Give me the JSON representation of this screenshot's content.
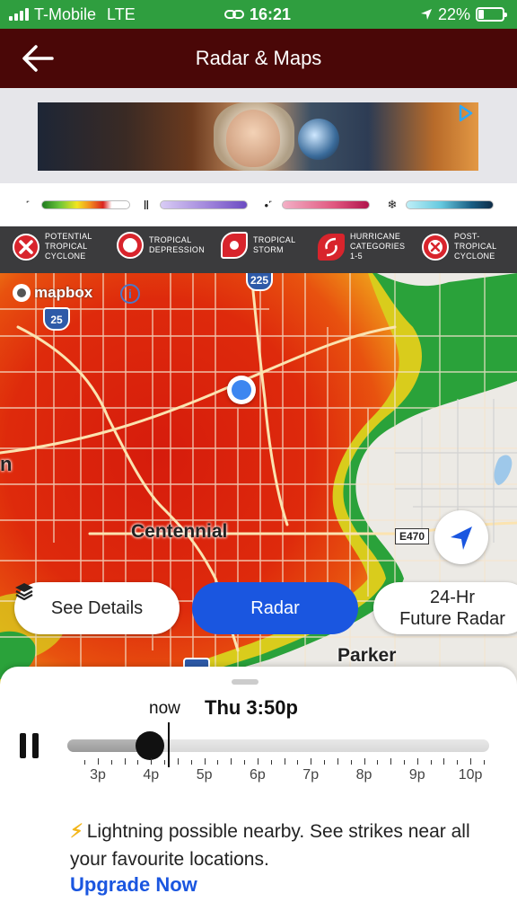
{
  "status_bar": {
    "carrier": "T-Mobile",
    "network": "LTE",
    "time": "16:21",
    "battery": "22%",
    "colors": {
      "background": "#2f9e3f"
    }
  },
  "header": {
    "title": "Radar & Maps",
    "back_icon": "arrow-left-icon",
    "background": "#4a0707"
  },
  "ad": {
    "choices_icon": "adchoices-icon"
  },
  "precip_legend": [
    {
      "icon": "rain-icon",
      "gradient": [
        "#1f7a1f",
        "#6cc63a",
        "#f2e51f",
        "#f28c1f",
        "#d9231f",
        "#ffffff"
      ]
    },
    {
      "icon": "sleet-icon",
      "gradient": [
        "#c9b8ef",
        "#9b7fd9",
        "#6b4bc2"
      ]
    },
    {
      "icon": "mix-icon",
      "gradient": [
        "#f3b0c6",
        "#e0577f",
        "#b0154c"
      ]
    },
    {
      "icon": "snow-icon",
      "gradient": [
        "#bfeff7",
        "#66c9df",
        "#1b5f84",
        "#0e2c47"
      ]
    }
  ],
  "tropical_legend": [
    {
      "icon": "potential-cyclone-icon",
      "label": "POTENTIAL TROPICAL CYCLONE"
    },
    {
      "icon": "depression-icon",
      "label": "TROPICAL DEPRESSION"
    },
    {
      "icon": "tropical-storm-icon",
      "label": "TROPICAL STORM"
    },
    {
      "icon": "hurricane-icon",
      "label": "HURRICANE CATEGORIES 1-5"
    },
    {
      "icon": "post-tropical-icon",
      "label": "POST-TROPICAL CYCLONE"
    }
  ],
  "map": {
    "attribution": "mapbox",
    "shields": {
      "i225": "225",
      "i25": "25"
    },
    "labels": {
      "centennial": "Centennial",
      "parker": "Parker",
      "left_edge": "n"
    },
    "highway": "E470"
  },
  "map_buttons": {
    "details": "See Details",
    "radar": "Radar",
    "future_line1": "24-Hr",
    "future_line2": "Future Radar"
  },
  "timeline": {
    "now_label": "now",
    "current_time": "Thu 3:50p",
    "hours": [
      "3p",
      "4p",
      "5p",
      "6p",
      "7p",
      "8p",
      "9p",
      "10p"
    ],
    "progress": 0.2
  },
  "promo": {
    "message": "Lightning possible nearby. See strikes near all your favourite locations.",
    "link": "Upgrade Now"
  }
}
